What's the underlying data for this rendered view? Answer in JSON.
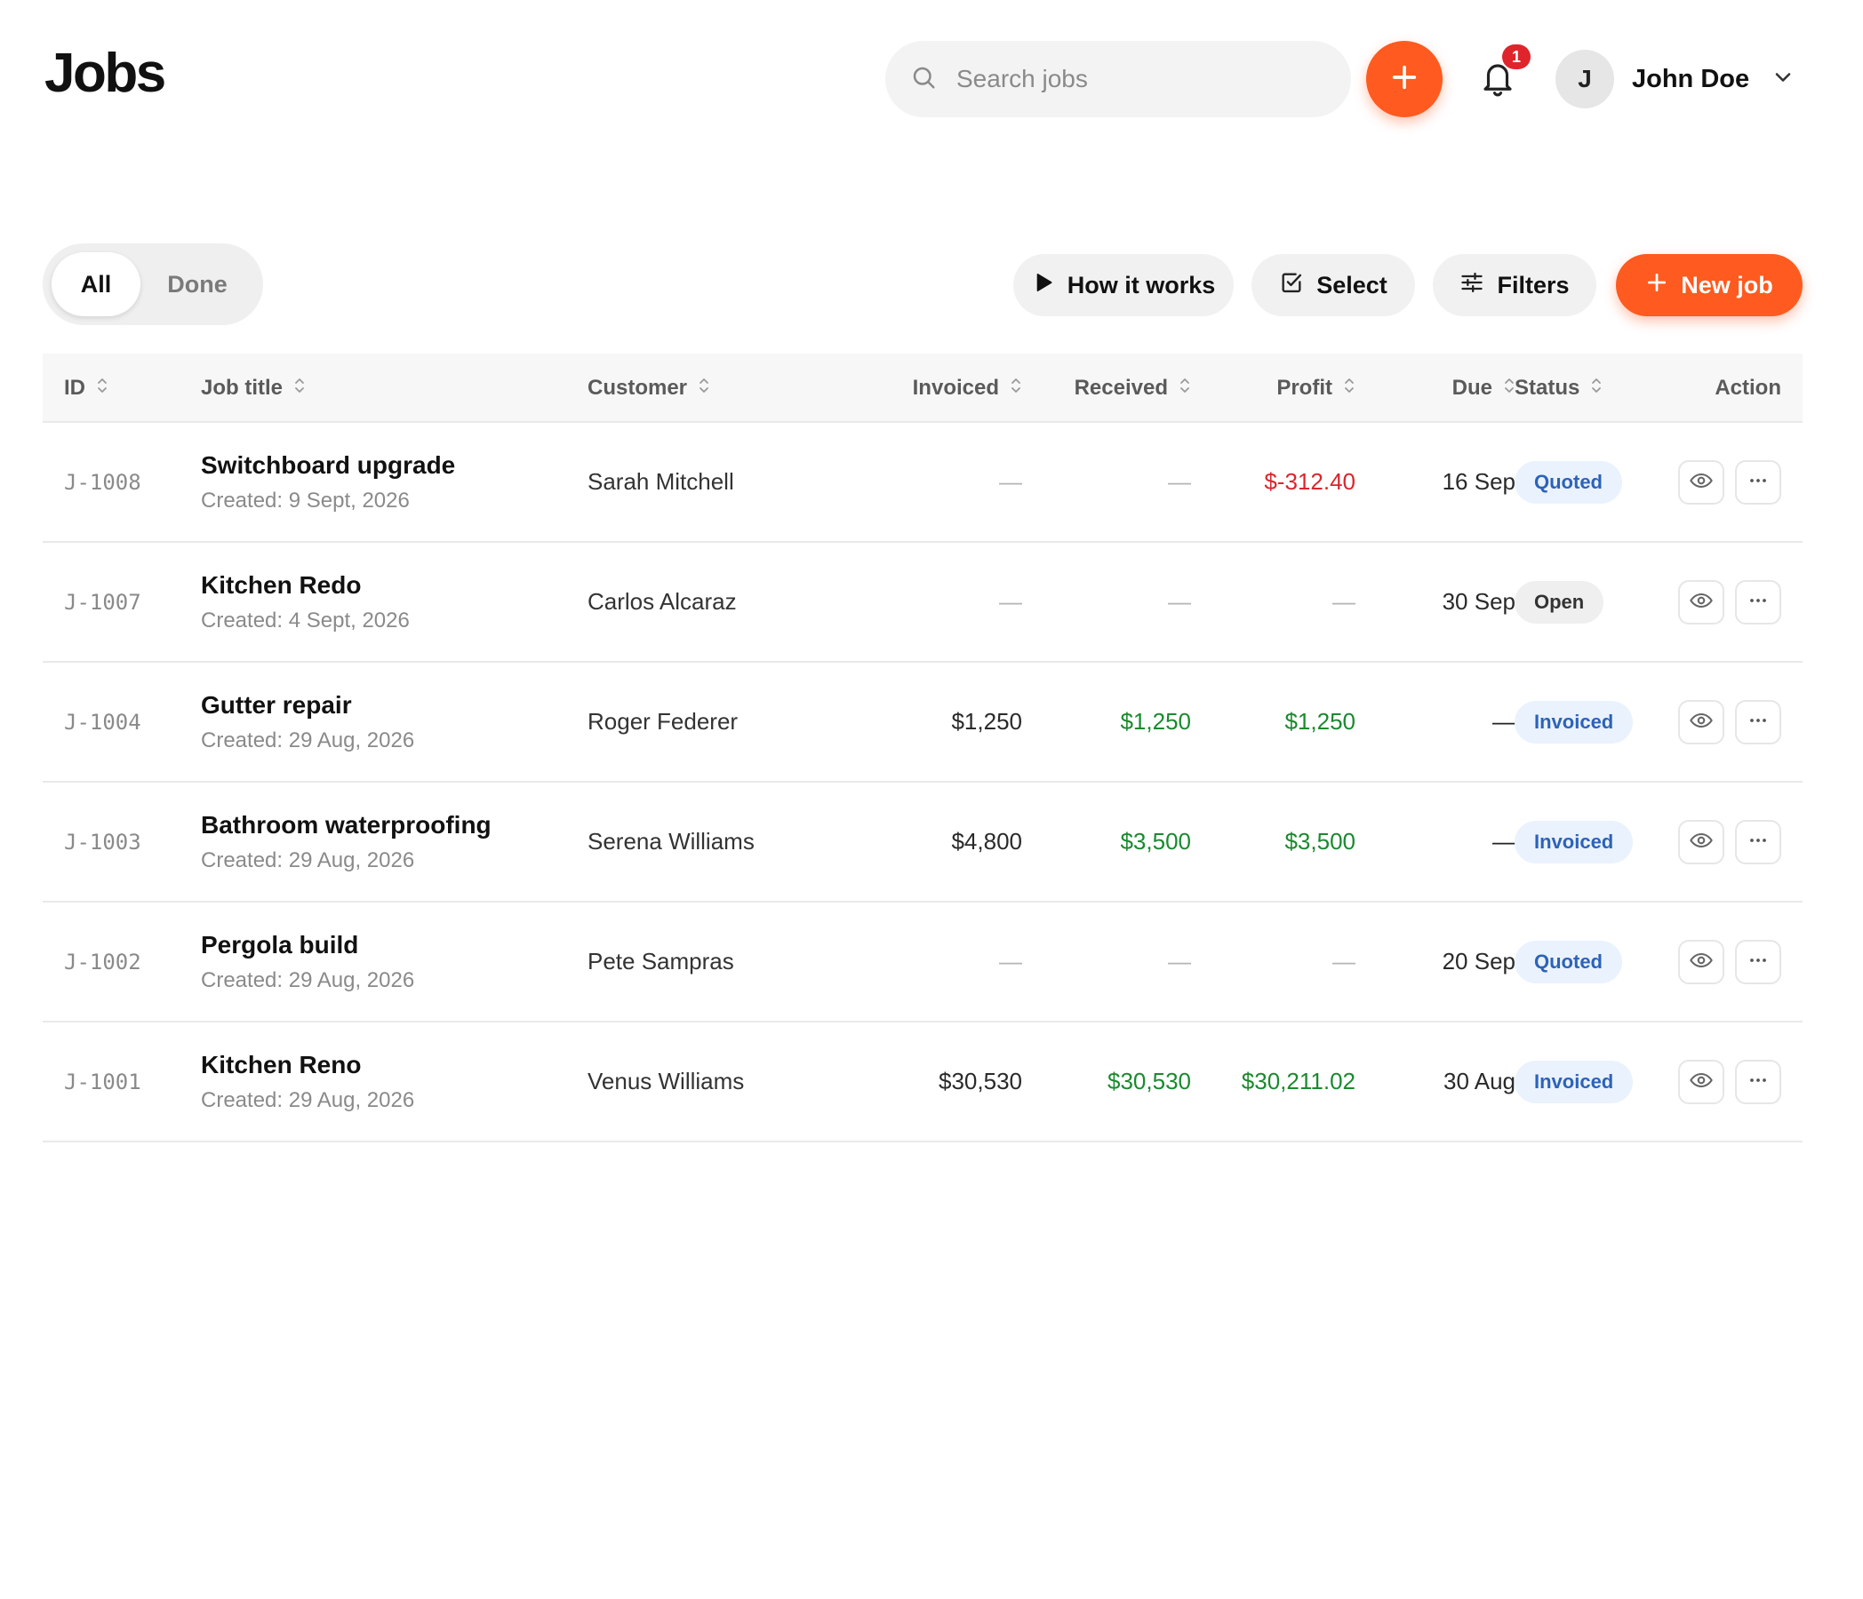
{
  "header": {
    "title": "Jobs",
    "search_placeholder": "Search jobs",
    "notification_count": "1",
    "user_initial": "J",
    "user_name": "John Doe"
  },
  "toolbar": {
    "tabs": [
      {
        "label": "All",
        "active": true
      },
      {
        "label": "Done",
        "active": false
      }
    ],
    "how_it_works": "How it works",
    "select": "Select",
    "filters": "Filters",
    "new_job": "New job"
  },
  "table": {
    "columns": [
      "ID",
      "Job title",
      "Customer",
      "Invoiced",
      "Received",
      "Profit",
      "Due",
      "Status",
      "Action"
    ],
    "rows": [
      {
        "id": "J-1008",
        "title": "Switchboard upgrade",
        "created": "Created: 9 Sept, 2026",
        "customer": "Sarah Mitchell",
        "invoiced": "—",
        "received": "—",
        "profit": "$-312.40",
        "due": "16 Sep",
        "status": "Quoted"
      },
      {
        "id": "J-1007",
        "title": "Kitchen Redo",
        "created": "Created: 4 Sept, 2026",
        "customer": "Carlos Alcaraz",
        "invoiced": "—",
        "received": "—",
        "profit": "—",
        "due": "30 Sep",
        "status": "Open"
      },
      {
        "id": "J-1004",
        "title": "Gutter repair",
        "created": "Created: 29 Aug, 2026",
        "customer": "Roger Federer",
        "invoiced": "$1,250",
        "received": "$1,250",
        "profit": "$1,250",
        "due": "—",
        "status": "Invoiced"
      },
      {
        "id": "J-1003",
        "title": "Bathroom waterproofing",
        "created": "Created: 29 Aug, 2026",
        "customer": "Serena Williams",
        "invoiced": "$4,800",
        "received": "$3,500",
        "profit": "$3,500",
        "due": "—",
        "status": "Invoiced"
      },
      {
        "id": "J-1002",
        "title": "Pergola build",
        "created": "Created: 29 Aug, 2026",
        "customer": "Pete Sampras",
        "invoiced": "—",
        "received": "—",
        "profit": "—",
        "due": "20 Sep",
        "status": "Quoted"
      },
      {
        "id": "J-1001",
        "title": "Kitchen Reno",
        "created": "Created: 29 Aug, 2026",
        "customer": "Venus Williams",
        "invoiced": "$30,530",
        "received": "$30,530",
        "profit": "$30,211.02",
        "due": "30 Aug",
        "status": "Invoiced"
      }
    ]
  },
  "colors": {
    "accent": "#ff5a1f",
    "positive": "#1a8a2e",
    "negative": "#d9262c",
    "badge_blue_bg": "#eaf2fd",
    "badge_blue_text": "#2c63b8",
    "badge_gray_bg": "#efefef",
    "badge_gray_text": "#333333"
  },
  "icons": {
    "search": "search-icon",
    "add": "plus-icon",
    "notifications": "bell-icon",
    "user_menu": "chevron-down-icon",
    "how_it_works": "play-icon",
    "select": "checkbox-icon",
    "filters": "sliders-icon",
    "sort": "sort-icon",
    "view": "eye-icon",
    "more": "more-horizontal-icon"
  }
}
